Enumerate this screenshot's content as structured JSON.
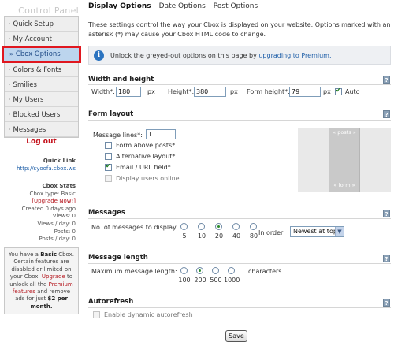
{
  "sidebar": {
    "title": "Control Panel",
    "items": [
      {
        "label": "Quick Setup",
        "active": false
      },
      {
        "label": "My Account",
        "active": false
      },
      {
        "label": "Cbox Options",
        "active": true
      },
      {
        "label": "Colors & Fonts",
        "active": false
      },
      {
        "label": "Smilies",
        "active": false
      },
      {
        "label": "My Users",
        "active": false
      },
      {
        "label": "Blocked Users",
        "active": false
      },
      {
        "label": "Messages",
        "active": false
      }
    ],
    "logout": "Log out",
    "quick_link": {
      "heading": "Quick Link",
      "url": "http://syoofa.cbox.ws"
    },
    "stats": {
      "heading": "Cbox Stats",
      "type": "Cbox type: Basic",
      "upgrade": "[Upgrade Now!]",
      "created": "Created 0 days ago",
      "views": "Views: 0",
      "views_day": "Views / day: 0",
      "posts": "Posts: 0",
      "posts_day": "Posts / day: 0"
    },
    "promo": {
      "p1": "You have a",
      "basic": "Basic",
      "p2": "Cbox. Certain features are disabled or limited on your Cbox.",
      "upgrade": "Upgrade",
      "p3": "to unlock all the",
      "premium": "Premium features",
      "p4": "and remove ads for just",
      "price": "$2 per month."
    }
  },
  "tabs": [
    {
      "label": "Display Options",
      "active": true
    },
    {
      "label": "Date Options",
      "active": false
    },
    {
      "label": "Post Options",
      "active": false
    }
  ],
  "intro": "These settings control the way your Cbox is displayed on your website. Options marked with an asterisk (*) may cause your Cbox HTML code to change.",
  "notice": {
    "text": "Unlock the greyed-out options on this page by",
    "link": "upgrading to Premium."
  },
  "width_height": {
    "title": "Width and height",
    "width_label": "Width*:",
    "width_value": "180",
    "width_unit": "px",
    "height_label": "Height*:",
    "height_value": "380",
    "height_unit": "px",
    "form_height_label": "Form height*:",
    "form_height_value": "79",
    "form_height_unit": "px",
    "auto_label": "Auto",
    "auto_checked": true
  },
  "form_layout": {
    "title": "Form layout",
    "message_lines_label": "Message lines*:",
    "message_lines_value": "1",
    "options": [
      {
        "label": "Form above posts*",
        "checked": false,
        "disabled": false
      },
      {
        "label": "Alternative layout*",
        "checked": false,
        "disabled": false
      },
      {
        "label": "Email / URL field*",
        "checked": true,
        "disabled": false
      },
      {
        "label": "Display users online",
        "checked": false,
        "disabled": true
      }
    ],
    "preview_posts": "« posts »",
    "preview_form": "« form »"
  },
  "messages": {
    "title": "Messages",
    "count_label": "No. of messages to display:",
    "count_options": [
      "5",
      "10",
      "20",
      "40",
      "80"
    ],
    "count_selected": "20",
    "order_label": "In order:",
    "order_value": "Newest at top"
  },
  "message_length": {
    "title": "Message length",
    "label": "Maximum message length:",
    "options": [
      "100",
      "200",
      "500",
      "1000"
    ],
    "selected": "200",
    "unit": "characters."
  },
  "autorefresh": {
    "title": "Autorefresh",
    "label": "Enable dynamic autorefresh",
    "checked": false,
    "disabled": true
  },
  "save_label": "Save",
  "help_glyph": "?",
  "info_glyph": "i",
  "bullet_glyph": "·",
  "active_bullet_glyph": "»",
  "select_arrow_glyph": "▼",
  "colors": {
    "accent": "#1f5fa8",
    "highlight_border": "#e0171f",
    "logout": "#c4101a"
  }
}
